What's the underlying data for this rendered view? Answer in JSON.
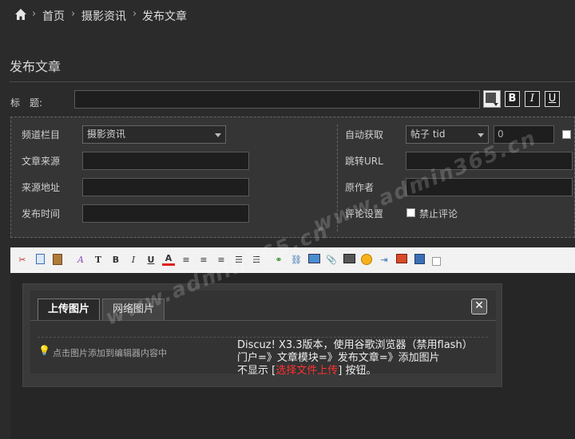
{
  "breadcrumb": {
    "items": [
      "首页",
      "摄影资讯",
      "发布文章"
    ]
  },
  "page": {
    "title": "发布文章"
  },
  "title_field": {
    "label": "标　题:",
    "value": ""
  },
  "format_buttons": {
    "bold": "B",
    "italic": "I",
    "underline": "U"
  },
  "settings": {
    "column_label": "频道栏目",
    "column_value": "摄影资讯",
    "source_label": "文章来源",
    "source_url_label": "来源地址",
    "publish_time_label": "发布时间",
    "auto_fetch_label": "自动获取",
    "auto_fetch_select": "帖子 tid",
    "auto_fetch_value": "0",
    "redirect_label": "跳转URL",
    "author_label": "原作者",
    "comment_label": "评论设置",
    "disable_comment_label": "禁止评论"
  },
  "dialog": {
    "tab_upload": "上传图片",
    "tab_web": "网络图片",
    "hint": "点击图片添加到编辑器内容中",
    "note_line1": "Discuz! X3.3版本，使用谷歌浏览器（禁用flash）",
    "note_line2": "门户=》文章模块=》发布文章=》添加图片",
    "note_line3_prefix": "不显示 [",
    "note_line3_highlight": "选择文件上传",
    "note_line3_suffix": "] 按钮。"
  },
  "watermark": {
    "text": "www.admin365.cn"
  },
  "colors": {
    "highlight": "#ff3333",
    "accent_border": "#dddddd"
  }
}
